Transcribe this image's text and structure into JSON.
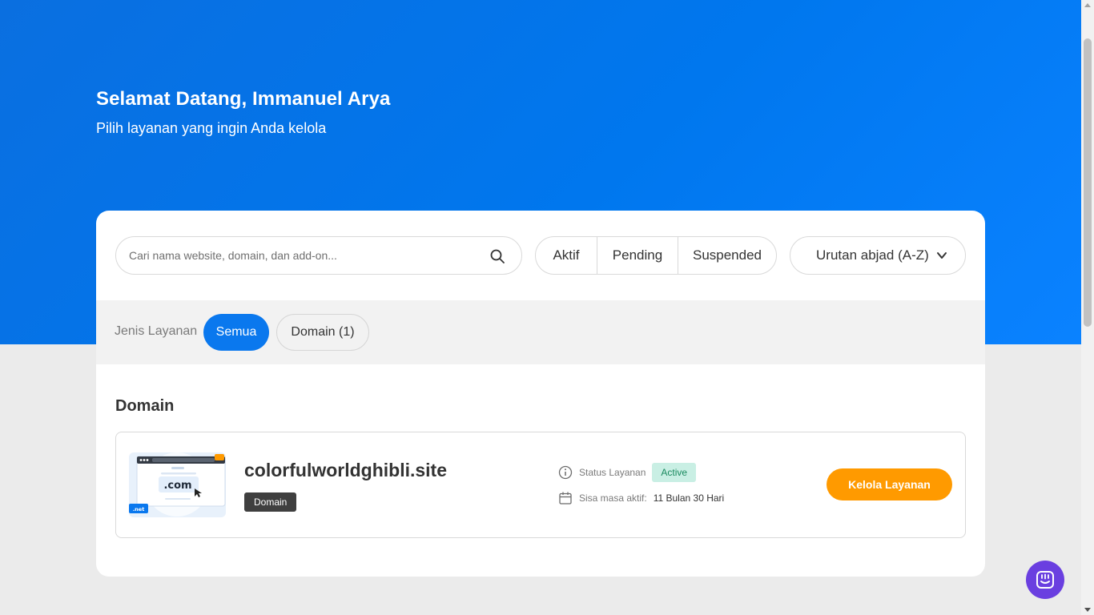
{
  "header": {
    "greeting": "Selamat Datang, Immanuel Arya",
    "subtitle": "Pilih layanan yang ingin Anda kelola"
  },
  "search": {
    "placeholder": "Cari nama website, domain, dan add-on...",
    "value": ""
  },
  "status_filters": [
    "Aktif",
    "Pending",
    "Suspended"
  ],
  "sort": {
    "selected": "Urutan abjad (A-Z)"
  },
  "service_type": {
    "label": "Jenis Layanan",
    "options": [
      "Semua",
      "Domain (1)"
    ],
    "selected": "Semua"
  },
  "section": {
    "title": "Domain"
  },
  "services": [
    {
      "name": "colorfulworldghibli.site",
      "type_badge": "Domain",
      "status_label": "Status Layanan",
      "status": "Active",
      "remaining_label": "Sisa masa aktif:",
      "remaining_value": "11 Bulan 30 Hari",
      "action_label": "Kelola Layanan",
      "thumbnail_tld": ".com",
      "thumbnail_sub_tld": ".net"
    }
  ],
  "colors": {
    "hero_blue": "#0a78ee",
    "accent_orange": "#ff9a00",
    "active_green_bg": "#c9efe4",
    "chat_purple": "#6a3fe0"
  }
}
